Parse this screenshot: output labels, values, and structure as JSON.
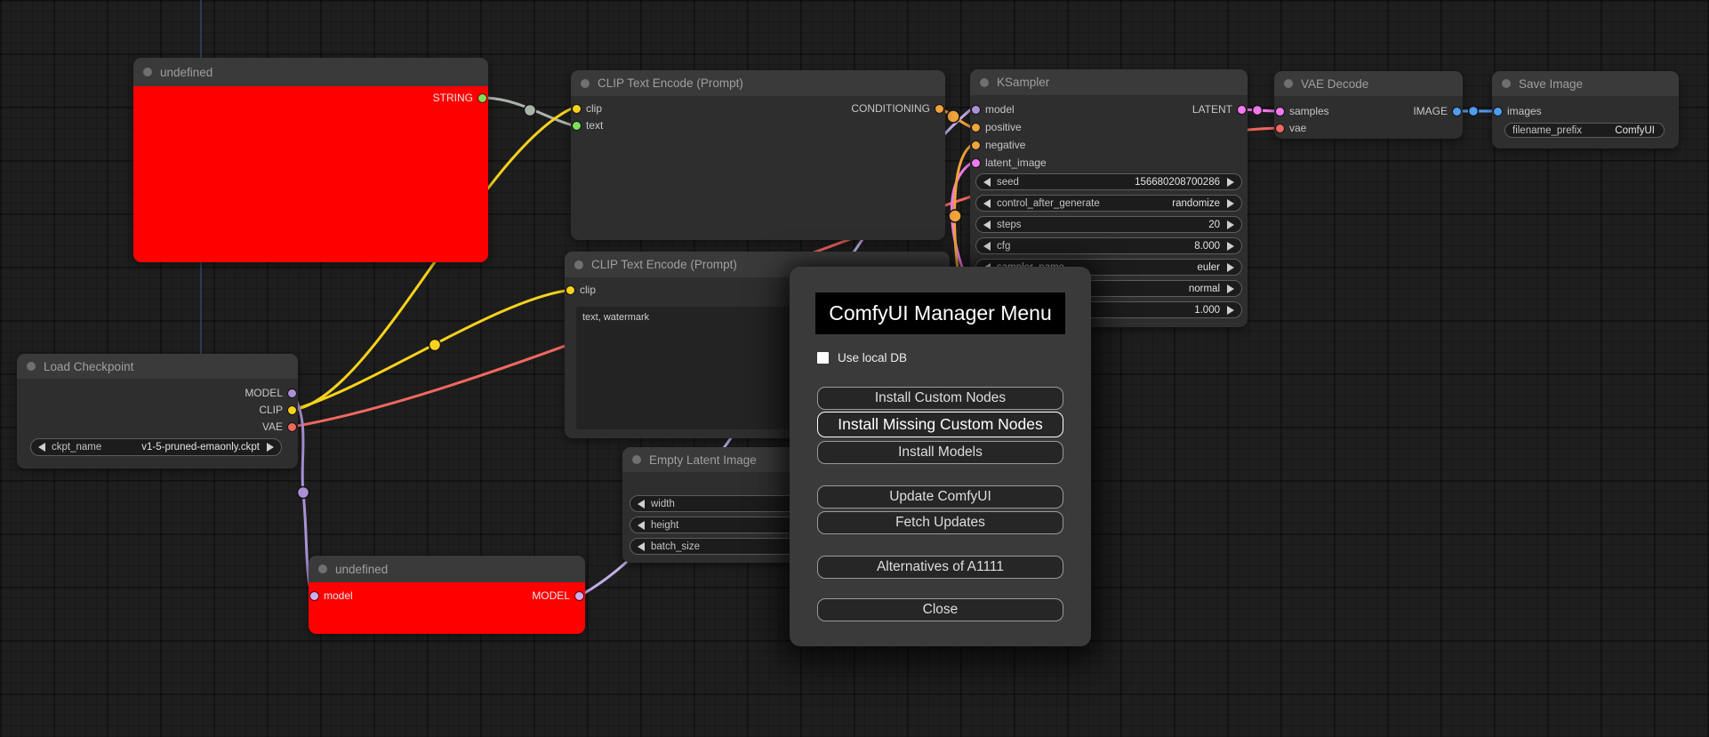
{
  "colors": {
    "wire_gray": "#a9b4aa",
    "wire_yellow": "#f8d21c",
    "wire_red": "#f2685f",
    "wire_purple": "#ab90d6",
    "wire_lavender": "#c3aee8",
    "wire_pink": "#f279ef",
    "wire_orange": "#f2a33c",
    "wire_blue": "#4e9ef0",
    "grid_line_blue": "#2e3a56",
    "node_error_bg": "#ff0000"
  },
  "nodes": {
    "undefined_top": {
      "title": "undefined",
      "output": {
        "label": "STRING",
        "color": "#7be05a"
      }
    },
    "clip_encode_top": {
      "title": "CLIP Text Encode (Prompt)",
      "inputs": [
        {
          "label": "clip",
          "color": "#f8d21c"
        },
        {
          "label": "text",
          "color": "#7be05a"
        }
      ],
      "output": {
        "label": "CONDITIONING",
        "color": "#f2a33c"
      }
    },
    "clip_encode_bottom": {
      "title": "CLIP Text Encode (Prompt)",
      "inputs": [
        {
          "label": "clip",
          "color": "#f8d21c"
        }
      ],
      "textarea_value": "text, watermark"
    },
    "ksampler": {
      "title": "KSampler",
      "inputs": [
        {
          "label": "model",
          "color": "#ab90d6"
        },
        {
          "label": "positive",
          "color": "#f2a33c"
        },
        {
          "label": "negative",
          "color": "#f2a33c"
        },
        {
          "label": "latent_image",
          "color": "#f279ef"
        }
      ],
      "output": {
        "label": "LATENT",
        "color": "#f279ef"
      },
      "widgets": [
        {
          "label": "seed",
          "value": "156680208700286"
        },
        {
          "label": "control_after_generate",
          "value": "randomize"
        },
        {
          "label": "steps",
          "value": "20"
        },
        {
          "label": "cfg",
          "value": "8.000"
        },
        {
          "label": "sampler_name",
          "value": "euler"
        },
        {
          "label": "",
          "value": "normal"
        },
        {
          "label": "",
          "value": "1.000"
        }
      ]
    },
    "vae_decode": {
      "title": "VAE Decode",
      "inputs": [
        {
          "label": "samples",
          "color": "#f279ef"
        },
        {
          "label": "vae",
          "color": "#f2685f"
        }
      ],
      "output": {
        "label": "IMAGE",
        "color": "#4e9ef0"
      }
    },
    "save_image": {
      "title": "Save Image",
      "inputs": [
        {
          "label": "images",
          "color": "#4e9ef0"
        }
      ],
      "widgets": [
        {
          "label": "filename_prefix",
          "value": "ComfyUI"
        }
      ]
    },
    "load_checkpoint": {
      "title": "Load Checkpoint",
      "outputs": [
        {
          "label": "MODEL",
          "color": "#ab90d6"
        },
        {
          "label": "CLIP",
          "color": "#f8d21c"
        },
        {
          "label": "VAE",
          "color": "#f2685f"
        }
      ],
      "widgets": [
        {
          "label": "ckpt_name",
          "value": "v1-5-pruned-emaonly.ckpt"
        }
      ]
    },
    "empty_latent": {
      "title": "Empty Latent Image",
      "widgets": [
        {
          "label": "width",
          "value": ""
        },
        {
          "label": "height",
          "value": ""
        },
        {
          "label": "batch_size",
          "value": ""
        }
      ]
    },
    "undefined_bottom": {
      "title": "undefined",
      "input": {
        "label": "model",
        "color": "#c9b1f0"
      },
      "output": {
        "label": "MODEL",
        "color": "#c9b1f0"
      }
    }
  },
  "dialog": {
    "title": "ComfyUI Manager Menu",
    "checkbox_label": "Use local DB",
    "checkbox_checked": false,
    "buttons": [
      {
        "label": "Install Custom Nodes"
      },
      {
        "label": "Install Missing Custom Nodes"
      },
      {
        "label": "Install Models"
      },
      {
        "label": "Update ComfyUI"
      },
      {
        "label": "Fetch Updates"
      },
      {
        "label": "Alternatives of A1111"
      },
      {
        "label": "Close"
      }
    ]
  }
}
